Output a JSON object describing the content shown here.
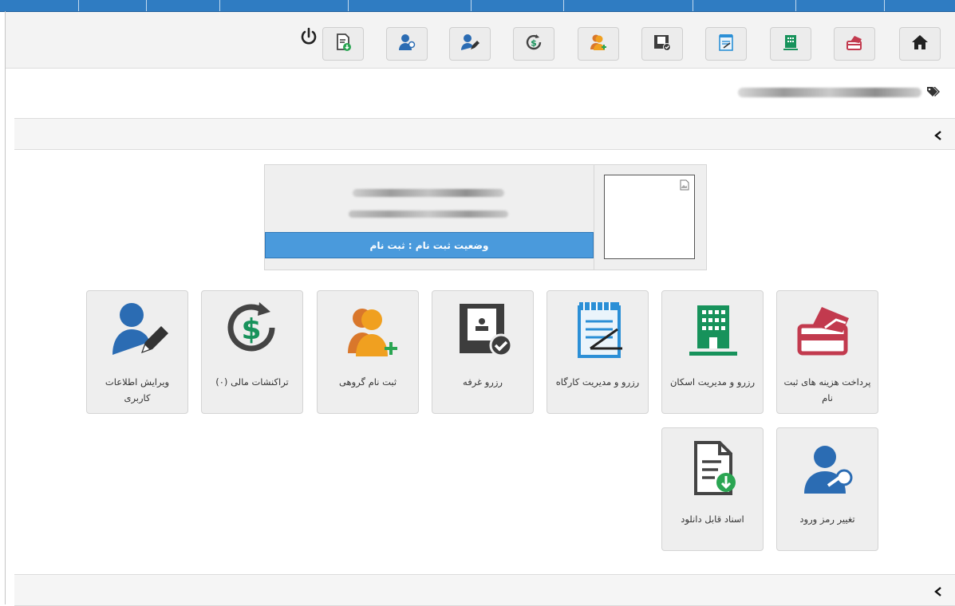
{
  "toolbar": {
    "buttons": [
      {
        "name": "home-icon"
      },
      {
        "name": "payment-card-icon"
      },
      {
        "name": "building-icon"
      },
      {
        "name": "notepad-icon"
      },
      {
        "name": "room-booking-icon"
      },
      {
        "name": "group-register-icon"
      },
      {
        "name": "transactions-icon"
      },
      {
        "name": "edit-user-icon"
      },
      {
        "name": "change-password-icon"
      },
      {
        "name": "download-doc-icon"
      }
    ],
    "logout_icon": "power-icon"
  },
  "breadcrumb": {
    "icon": "tags-icon"
  },
  "profile": {
    "status_text": "وضعیت ثبت نام : ثبت نام",
    "photo_icon": "broken-image-icon"
  },
  "tiles": [
    {
      "label": "پرداخت هزینه های ثبت نام",
      "icon": "payment-card-icon"
    },
    {
      "label": "رزرو و مدیریت اسکان",
      "icon": "building-icon"
    },
    {
      "label": "رزرو و مدیریت کارگاه",
      "icon": "notepad-icon"
    },
    {
      "label": "رزرو غرفه",
      "icon": "room-booking-icon"
    },
    {
      "label": "ثبت نام گروهی",
      "icon": "group-register-icon"
    },
    {
      "label": "تراکنشات مالی (۰)",
      "icon": "transactions-icon"
    },
    {
      "label": "ویرایش اطلاعات کاربری",
      "icon": "edit-user-icon"
    },
    {
      "label": "تغییر رمز ورود",
      "icon": "change-password-icon"
    },
    {
      "label": "اسناد قابل دانلود",
      "icon": "download-doc-icon"
    }
  ],
  "colors": {
    "accent": "#2f7cc2",
    "status_bar": "#4a9adc",
    "icon_blue": "#2b6cb3",
    "icon_green": "#17925b",
    "icon_orange": "#f0a020",
    "icon_red": "#c23a4e",
    "icon_dark": "#3d3d3d"
  }
}
